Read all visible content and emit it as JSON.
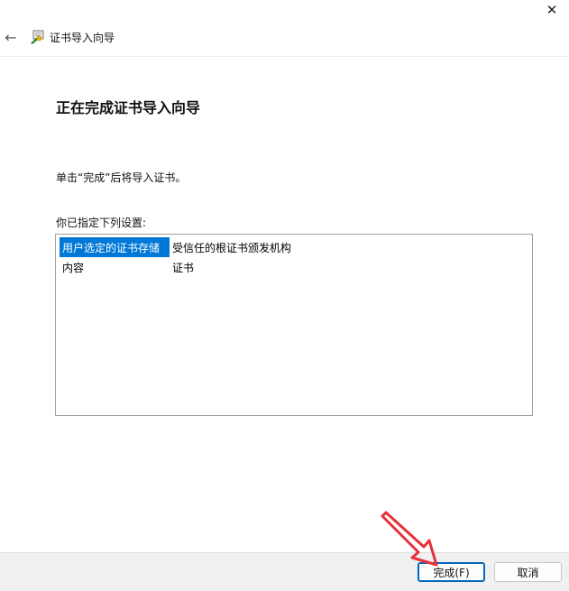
{
  "window": {
    "title": "证书导入向导",
    "close_symbol": "✕",
    "back_symbol": "←"
  },
  "page": {
    "heading": "正在完成证书导入向导",
    "instruction": "单击“完成”后将导入证书。",
    "settings_label": "你已指定下列设置:"
  },
  "settings": [
    {
      "key": "用户选定的证书存储",
      "value": "受信任的根证书颁发机构",
      "selected": true
    },
    {
      "key": "内容",
      "value": "证书",
      "selected": false
    }
  ],
  "buttons": {
    "finish": "完成(F)",
    "cancel": "取消"
  },
  "colors": {
    "selection": "#0078d7",
    "annotation_arrow": "#e8303a",
    "default_button_border": "#0067c0"
  },
  "icons": [
    "close-icon",
    "back-arrow-icon",
    "certificate-icon",
    "annotation-arrow"
  ]
}
